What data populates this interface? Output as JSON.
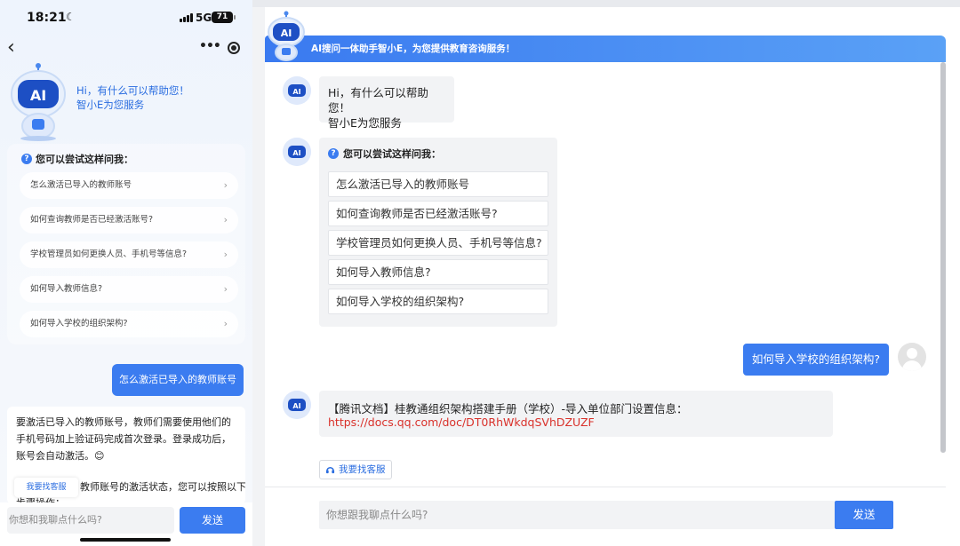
{
  "mobile": {
    "status_bar": {
      "time": "18:21",
      "network": "5G",
      "battery": "71"
    },
    "greeting": {
      "line1": "Hi，有什么可以帮助您！",
      "line2": "智小E为您服务"
    },
    "suggest_title": "您可以尝试这样问我：",
    "suggestions": [
      "怎么激活已导入的教师账号",
      "如何查询教师是否已经激活账号?",
      "学校管理员如何更换人员、手机号等信息?",
      "如何导入教师信息?",
      "如何导入学校的组织架构?"
    ],
    "user_message": "怎么激活已导入的教师账号",
    "answer_text": "要激活已导入的教师账号，教师们需要使用他们的手机号码加上验证码完成首次登录。登录成功后，账号会自动激活。😊",
    "answer_tail": "教师账号的激活状态，您可以按照以下",
    "answer_tail2": "步骤操作：",
    "customer_service": "我要找客服",
    "input_placeholder": "你想和我聊点什么吗?",
    "send_label": "发送"
  },
  "desktop": {
    "banner_title": "AI搜问一体助手智小E，为您提供教育咨询服务！",
    "greeting": {
      "line1": "Hi，有什么可以帮助您！",
      "line2": "智小E为您服务"
    },
    "suggest_title": "您可以尝试这样问我：",
    "suggestions": [
      "怎么激活已导入的教师账号",
      "如何查询教师是否已经激活账号?",
      "学校管理员如何更换人员、手机号等信息?",
      "如何导入教师信息?",
      "如何导入学校的组织架构?"
    ],
    "user_message": "如何导入学校的组织架构?",
    "link_answer": {
      "text": "【腾讯文档】桂教通组织架构搭建手册（学校）-导入单位部门设置信息：",
      "url": "https://docs.qq.com/doc/DT0RhWkdqSVhDZUZF"
    },
    "customer_service": "我要找客服",
    "input_placeholder": "你想跟我聊点什么吗?",
    "send_label": "发送"
  },
  "colors": {
    "accent": "#3b7cf0",
    "link": "#d9312b"
  },
  "icons": [
    "robot-ai-icon",
    "question-icon",
    "chevron-right-icon",
    "back-arrow-icon",
    "more-icon",
    "target-icon",
    "headset-icon",
    "user-avatar-icon"
  ]
}
